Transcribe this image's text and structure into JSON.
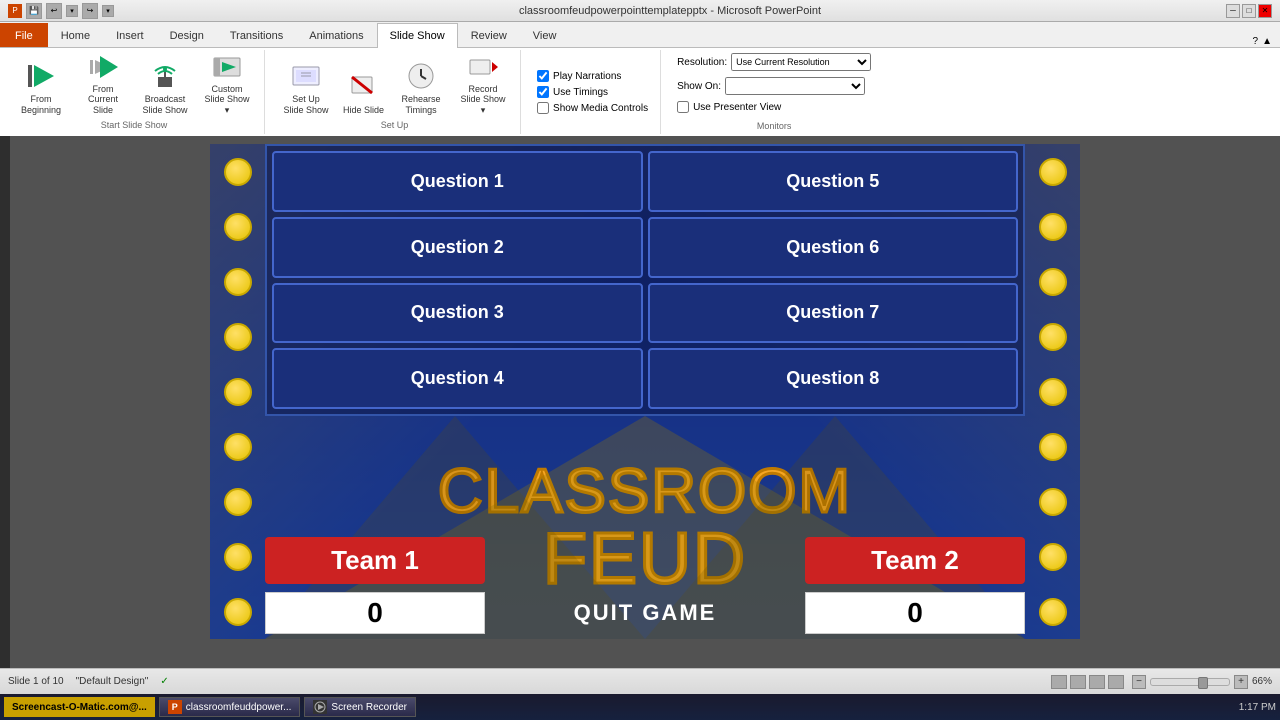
{
  "titleBar": {
    "title": "classroomfeudpowerpointtemplatepptx - Microsoft PowerPoint",
    "minimize": "─",
    "restore": "□",
    "close": "✕"
  },
  "ribbon": {
    "tabs": [
      "File",
      "Home",
      "Insert",
      "Design",
      "Transitions",
      "Animations",
      "Slide Show",
      "Review",
      "View"
    ],
    "activeTab": "Slide Show",
    "groups": {
      "startSlideShow": {
        "label": "Start Slide Show",
        "buttons": [
          {
            "id": "from-beginning",
            "label": "From Beginning",
            "icon": "▶"
          },
          {
            "id": "from-current",
            "label": "From Current Slide",
            "icon": "▶"
          },
          {
            "id": "broadcast",
            "label": "Broadcast Slide Show",
            "icon": "📡"
          },
          {
            "id": "custom",
            "label": "Custom Slide Show",
            "icon": "▶"
          }
        ]
      },
      "setup": {
        "label": "Set Up",
        "buttons": [
          {
            "id": "setup-slideshow",
            "label": "Set Up Slide Show",
            "icon": "⚙"
          },
          {
            "id": "hide-slide",
            "label": "Hide Slide",
            "icon": "🚫"
          },
          {
            "id": "rehearse",
            "label": "Rehearse Timings",
            "icon": "⏱"
          },
          {
            "id": "record",
            "label": "Record Slide Show",
            "icon": "⏺"
          }
        ]
      },
      "monitors": {
        "label": "Monitors",
        "resolution": "Resolution:",
        "resolutionValue": "Use Current Resolution",
        "showOn": "Show On:",
        "showOnValue": "",
        "usePresenterView": "Use Presenter View"
      }
    },
    "checkboxes": {
      "playNarrations": {
        "label": "Play Narrations",
        "checked": true
      },
      "useTimings": {
        "label": "Use Timings",
        "checked": true
      },
      "showMediaControls": {
        "label": "Show Media Controls",
        "checked": false
      }
    }
  },
  "slide": {
    "questions": [
      {
        "id": 1,
        "label": "Question 1"
      },
      {
        "id": 2,
        "label": "Question 2"
      },
      {
        "id": 3,
        "label": "Question 3"
      },
      {
        "id": 4,
        "label": "Question 4"
      },
      {
        "id": 5,
        "label": "Question 5"
      },
      {
        "id": 6,
        "label": "Question 6"
      },
      {
        "id": 7,
        "label": "Question 7"
      },
      {
        "id": 8,
        "label": "Question 8"
      }
    ],
    "gameTitle": {
      "line1": "CLASSROOM",
      "line2": "FEUD"
    },
    "team1": {
      "label": "Team 1",
      "score": "0"
    },
    "team2": {
      "label": "Team 2",
      "score": "0"
    },
    "quitButton": "QUIT GAME"
  },
  "statusBar": {
    "slideInfo": "Slide 1 of 10",
    "theme": "\"Default Design\"",
    "zoom": "66%"
  },
  "taskbar": {
    "screencast": "Screencast-O-Matic.com@...",
    "powerpoint": "classroomfeuddpower...",
    "recorder": "Screen Recorder",
    "time": "1:17 PM"
  }
}
